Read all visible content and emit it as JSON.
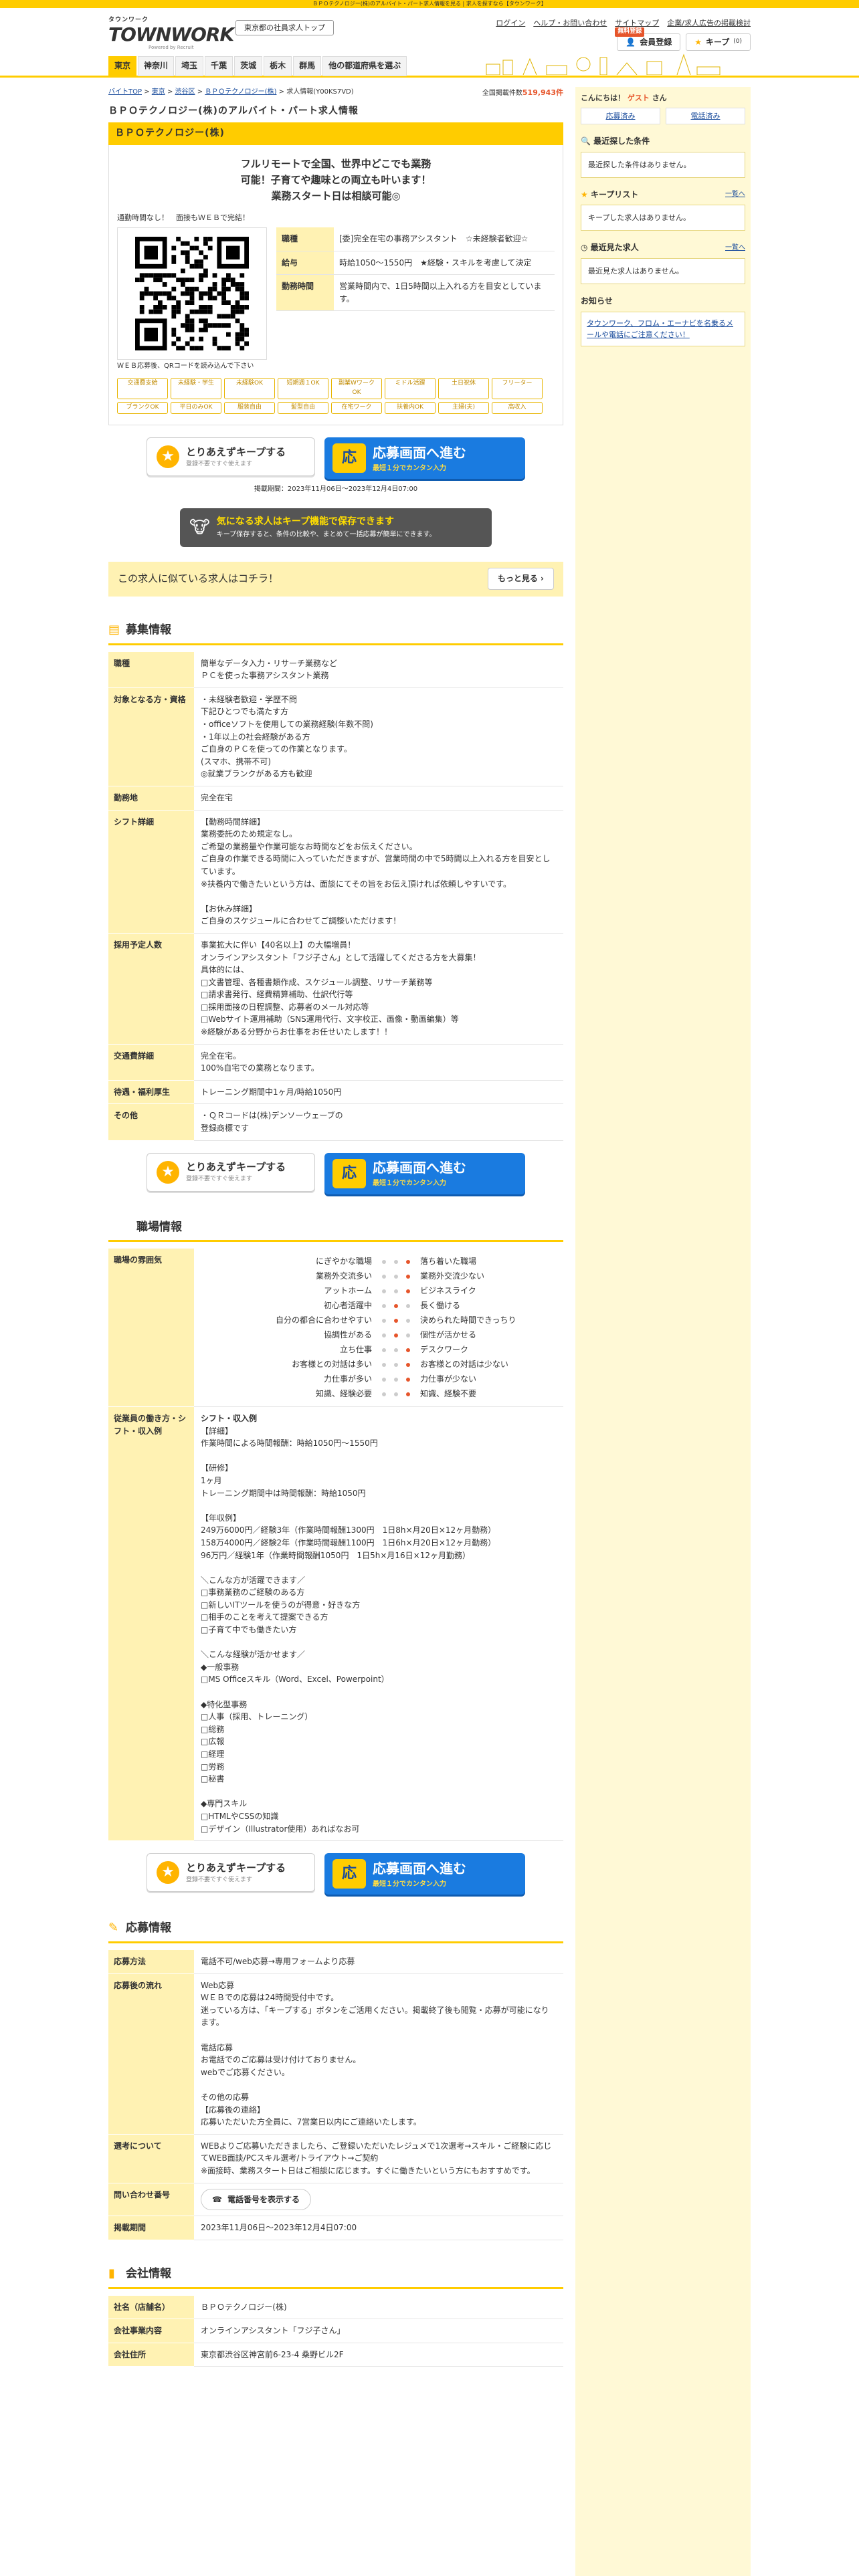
{
  "topbar_text": "ＢＰＯテクノロジー(株)のアルバイト・パート求人情報を見る | 求人を探すなら【タウンワーク】",
  "header": {
    "logo_small": "タウンワーク",
    "logo_big": "TOWNWORK",
    "logo_by": "Powered by Recruit",
    "area_button": "東京都の社員求人トップ",
    "links": [
      "ログイン",
      "ヘルプ・お問い合わせ",
      "サイトマップ",
      "企業/求人広告の掲載検討"
    ],
    "register_badge": "無料登録",
    "register_button": "会員登録",
    "keep_button": "キープ",
    "keep_count": "(0)"
  },
  "nav": {
    "items": [
      "東京",
      "神奈川",
      "埼玉",
      "千葉",
      "茨城",
      "栃木",
      "群馬",
      "他の都道府県を選ぶ"
    ]
  },
  "breadcrumb": {
    "items": [
      "バイトTOP",
      "東京",
      "渋谷区",
      "ＢＰＯテクノロジー(株)",
      "求人情報(Y00KS7VD)"
    ],
    "count_label": "全国掲載件数",
    "count": "519,943件"
  },
  "page_title": "ＢＰＯテクノロジー(株)のアルバイト・パート求人情報",
  "company_name": "ＢＰＯテクノロジー(株)",
  "catch": [
    "フルリモートで全国、世界中どこでも業務",
    "可能！子育てや趣味との両立も叶います！",
    "業務スタート日は相談可能◎"
  ],
  "note": "通勤時間なし！　面接もＷＥＢで完結！",
  "qr_caption": "ＷＥＢ応募後、QRコードを読み込んで下さい",
  "summary": [
    {
      "th": "職種",
      "td": "[委]完全在宅の事務アシスタント　☆未経験者歓迎☆"
    },
    {
      "th": "給与",
      "td": "時給1050〜1550円　★経験・スキルを考慮して決定"
    },
    {
      "th": "勤務時間",
      "td": "営業時間内で、1日5時間以上入れる方を目安としています。"
    }
  ],
  "tags": [
    "交通費支給",
    "未経験・学生",
    "未経験OK",
    "短期週１OK",
    "副業WワークOK",
    "ミドル活躍",
    "土日祝休",
    "フリーター",
    "ブランクOK",
    "平日のみOK",
    "服装自由",
    "髪型自由",
    "在宅ワーク",
    "扶養内OK",
    "主婦(夫)",
    "高収入"
  ],
  "keep_btn": {
    "t1": "とりあえずキープする",
    "t2": "登録不要ですぐ使えます"
  },
  "apply_btn": {
    "t1": "応募画面へ進む",
    "t2": "最短１分でカンタン入力",
    "icon": "応"
  },
  "period": "掲載期間：2023年11月06日〜2023年12月4日07:00",
  "keep_banner": {
    "t1": "気になる求人はキープ機能で保存できます",
    "t2": "キープ保存すると、条件の比較や、まとめて一括応募が簡単にできます。"
  },
  "similar": {
    "text": "この求人に似ている求人はコチラ！",
    "more": "もっと見る"
  },
  "recruit": {
    "title": "募集情報",
    "rows": [
      {
        "th": "職種",
        "td": "簡単なデータ入力・リサーチ業務など\nＰＣを使った事務アシスタント業務"
      },
      {
        "th": "対象となる方・資格",
        "td": "・未経験者歓迎・学歴不問\n下記ひとつでも満たす方\n・officeソフトを使用しての業務経験(年数不問)\n・1年以上の社会経験がある方\nご自身のＰＣを使っての作業となります。\n(スマホ、携帯不可)\n◎就業ブランクがある方も歓迎"
      },
      {
        "th": "勤務地",
        "td": "完全在宅"
      },
      {
        "th": "シフト詳細",
        "td": "【勤務時間詳細】\n業務委託のため規定なし。\nご希望の業務量や作業可能なお時間などをお伝えください。\nご自身の作業できる時間に入っていただきますが、営業時間の中で5時間以上入れる方を目安としています。\n※扶養内で働きたいという方は、面談にてその旨をお伝え頂ければ依頼しやすいです。\n\n【お休み詳細】\nご自身のスケジュールに合わせてご調整いただけます！"
      },
      {
        "th": "採用予定人数",
        "td": "事業拡大に伴い【40名以上】の大幅増員！\nオンラインアシスタント「フジ子さん」として活躍してくださる方を大募集！\n具体的には、\n□文書管理、各種書類作成、スケジュール調整、リサーチ業務等\n□請求書発行、経費精算補助、仕訳代行等\n□採用面接の日程調整、応募者のメール対応等\n□Webサイト運用補助（SNS運用代行、文字校正、画像・動画編集）等\n※経験がある分野からお仕事をお任せいたします！！"
      },
      {
        "th": "交通費詳細",
        "td": "完全在宅。\n100%自宅での業務となります。"
      },
      {
        "th": "待遇・福利厚生",
        "td": "トレーニング期間中1ヶ月/時給1050円"
      },
      {
        "th": "その他",
        "td": "・ＱＲコードは(株)デンソーウェーブの\n登録商標です"
      }
    ]
  },
  "workplace": {
    "title": "職場情報",
    "env_th": "職場の雰囲気",
    "env": [
      {
        "l": "にぎやかな職場",
        "r": "落ち着いた職場",
        "pos": 3
      },
      {
        "l": "業務外交流多い",
        "r": "業務外交流少ない",
        "pos": 3
      },
      {
        "l": "アットホーム",
        "r": "ビジネスライク",
        "pos": 3
      },
      {
        "l": "初心者活躍中",
        "r": "長く働ける",
        "pos": 2
      },
      {
        "l": "自分の都合に合わせやすい",
        "r": "決められた時間できっちり",
        "pos": 2
      },
      {
        "l": "協調性がある",
        "r": "個性が活かせる",
        "pos": 2
      },
      {
        "l": "立ち仕事",
        "r": "デスクワーク",
        "pos": 3
      },
      {
        "l": "お客様との対話は多い",
        "r": "お客様との対話は少ない",
        "pos": 3
      },
      {
        "l": "力仕事が多い",
        "r": "力仕事が少ない",
        "pos": 3
      },
      {
        "l": "知識、経験必要",
        "r": "知識、経験不要",
        "pos": 3
      }
    ],
    "voice_th": "従業員の働き方・シフト・収入例",
    "voice_title": "シフト・収入例",
    "voice": "【詳細】\n作業時間による時間報酬：時給1050円〜1550円\n\n【研修】\n1ヶ月\nトレーニング期間中は時間報酬：時給1050円\n\n【年収例】\n249万6000円／経験3年（作業時間報酬1300円　1日8h×月20日×12ヶ月勤務）\n158万4000円／経験2年（作業時間報酬1100円　1日6h×月20日×12ヶ月勤務）\n96万円／経験1年（作業時間報酬1050円　1日5h×月16日×12ヶ月勤務）\n\n＼こんな方が活躍できます／\n□事務業務のご経験のある方\n□新しいITツールを使うのが得意・好きな方\n□相手のことを考えて提案できる方\n□子育て中でも働きたい方\n\n＼こんな経験が活かせます／\n◆一般事務\n□MS Officeスキル（Word、Excel、Powerpoint）\n\n◆特化型事務\n□人事（採用、トレーニング）\n□総務\n□広報\n□経理\n□労務\n□秘書\n\n◆専門スキル\n□HTMLやCSSの知識\n□デザイン（Illustrator使用）あればなお可"
  },
  "apply": {
    "title": "応募情報",
    "rows": [
      {
        "th": "応募方法",
        "td": "電話不可/web応募→専用フォームより応募"
      },
      {
        "th": "応募後の流れ",
        "td": "Web応募\nＷＥＢでの応募は24時間受付中です。\n迷っている方は、「キープする」ボタンをご活用ください。掲載終了後も閲覧・応募が可能になります。\n\n電話応募\nお電話でのご応募は受け付けておりません。\nwebでご応募ください。\n\nその他の応募\n【応募後の連絡】\n応募いただいた方全員に、7営業日以内にご連絡いたします。"
      },
      {
        "th": "選考について",
        "td": "WEBよりご応募いただきましたら、ご登録いただいたレジュメで1次選考→スキル・ご経験に応じてWEB面談/PCスキル選考/トライアウト→ご契約\n※面接時、業務スタート日はご相談に応じます。すぐに働きたいという方にもおすすめです。"
      }
    ],
    "tel_th": "問い合わせ番号",
    "tel_btn": "電話番号を表示する",
    "period_th": "掲載期間",
    "period_td": "2023年11月06日〜2023年12月4日07:00"
  },
  "company": {
    "title": "会社情報",
    "rows": [
      {
        "th": "社名（店舗名）",
        "td": "ＢＰＯテクノロジー(株)"
      },
      {
        "th": "会社事業内容",
        "td": "オンラインアシスタント「フジ子さん」"
      },
      {
        "th": "会社住所",
        "td": "東京都渋谷区神宮前6-23-4 桑野ビル2F"
      }
    ]
  },
  "side": {
    "greet_prefix": "こんにちは！",
    "greet_name": "ゲスト",
    "greet_suffix": "さん",
    "links": [
      "応募済み",
      "電話済み"
    ],
    "cond_title": "最近探した条件",
    "cond_empty": "最近探した条件はありません。",
    "keep_title": "キープリスト",
    "keep_link": "一覧へ",
    "keep_empty": "キープした求人はありません。",
    "viewed_title": "最近見た求人",
    "viewed_link": "一覧へ",
    "viewed_empty": "最近見た求人はありません。",
    "news_title": "お知らせ",
    "news": "タウンワーク、フロム・エーナビを名乗るメールや電話にご注意ください！"
  }
}
